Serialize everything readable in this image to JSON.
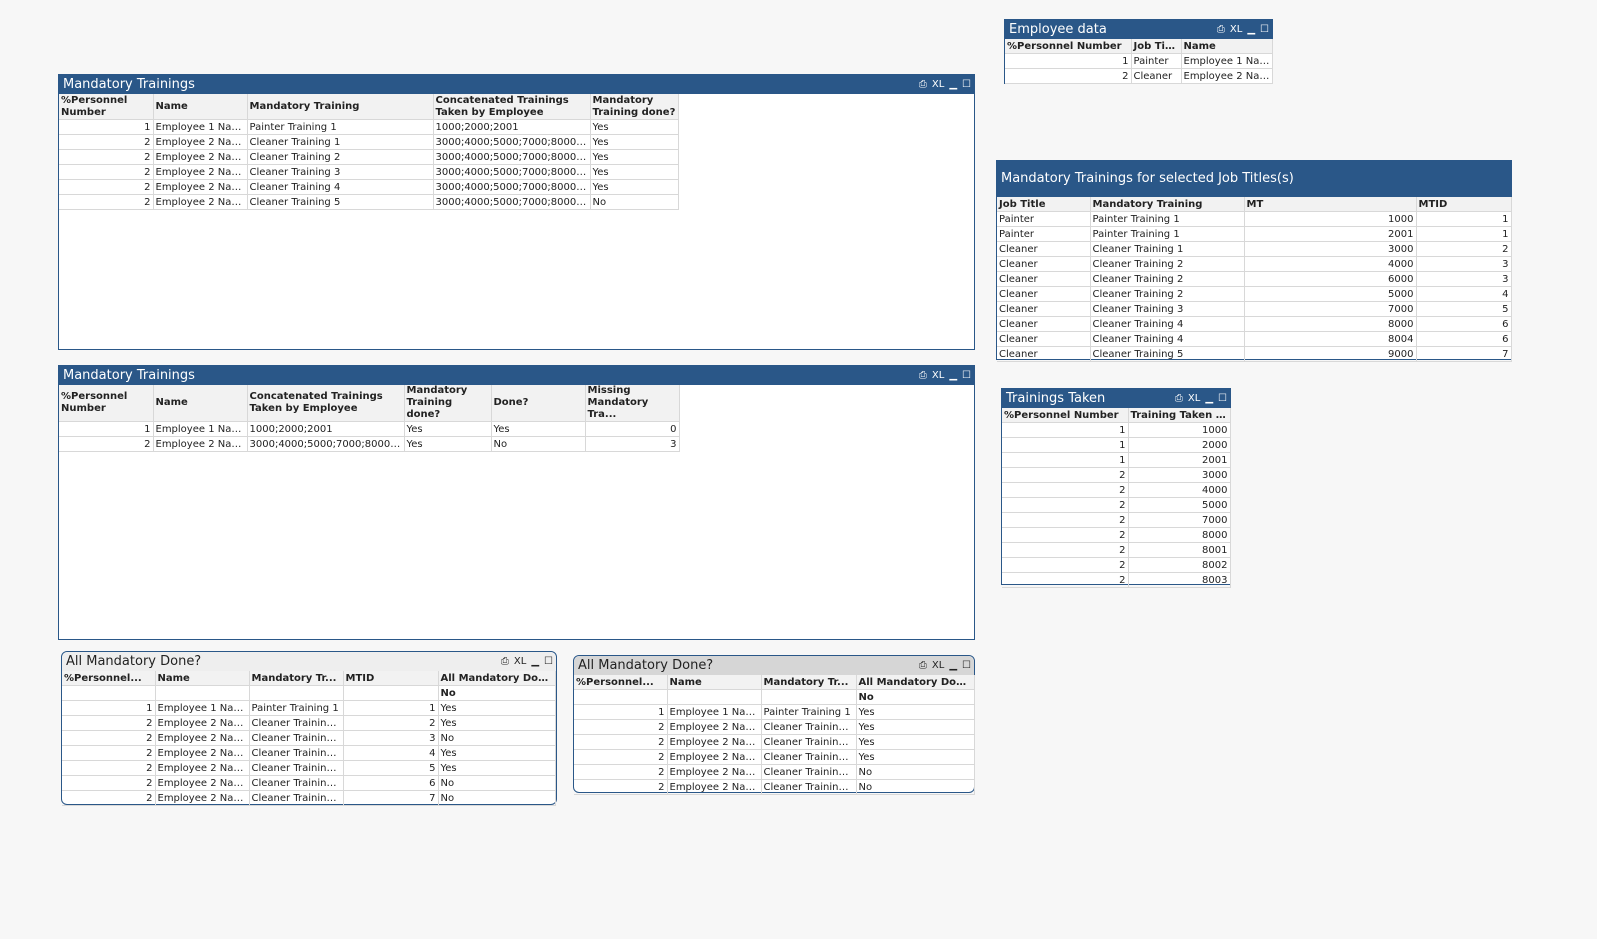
{
  "controls": {
    "print": "⎙",
    "xl": "XL",
    "min": "▁",
    "max": "☐"
  },
  "colors": {
    "title_bar": "#2a5788",
    "background": "#f7f7f7"
  },
  "panels": [
    {
      "id": "mt1",
      "title": "Mandatory Trainings",
      "headers": [
        "%Personnel Number",
        "Name",
        "Mandatory Training",
        "Concatenated Trainings Taken by Employee",
        "Mandatory Training done?"
      ],
      "rows": [
        [
          "1",
          "Employee 1 Name",
          "Painter Training 1",
          "1000;2000;2001",
          "Yes"
        ],
        [
          "2",
          "Employee 2 Name",
          "Cleaner Training 1",
          "3000;4000;5000;7000;8000;...",
          "Yes"
        ],
        [
          "2",
          "Employee 2 Name",
          "Cleaner Training 2",
          "3000;4000;5000;7000;8000;...",
          "Yes"
        ],
        [
          "2",
          "Employee 2 Name",
          "Cleaner Training 3",
          "3000;4000;5000;7000;8000;...",
          "Yes"
        ],
        [
          "2",
          "Employee 2 Name",
          "Cleaner Training 4",
          "3000;4000;5000;7000;8000;...",
          "Yes"
        ],
        [
          "2",
          "Employee 2 Name",
          "Cleaner Training 5",
          "3000;4000;5000;7000;8000;...",
          "No"
        ]
      ]
    },
    {
      "id": "mt2",
      "title": "Mandatory Trainings",
      "headers": [
        "%Personnel Number",
        "Name",
        "Concatenated Trainings Taken by Employee",
        "Mandatory Training done?",
        "Done?",
        "Missing Mandatory Tra..."
      ],
      "rows": [
        [
          "1",
          "Employee 1 Name",
          "1000;2000;2001",
          "Yes",
          "Yes",
          "0"
        ],
        [
          "2",
          "Employee 2 Name",
          "3000;4000;5000;7000;8000;...",
          "Yes",
          "No",
          "3"
        ]
      ]
    },
    {
      "id": "amd1",
      "title": "All Mandatory Done?",
      "headers": [
        "%Personnel...",
        "Name",
        "Mandatory Tr...",
        "MTID",
        "All Mandatory Done?"
      ],
      "total": [
        "",
        "",
        "",
        "",
        "No"
      ],
      "rows": [
        [
          "1",
          "Employee 1 Name",
          "Painter Training 1",
          "1",
          "Yes"
        ],
        [
          "2",
          "Employee 2 Name",
          "Cleaner Training 1",
          "2",
          "Yes"
        ],
        [
          "2",
          "Employee 2 Name",
          "Cleaner Training 2",
          "3",
          "No"
        ],
        [
          "2",
          "Employee 2 Name",
          "Cleaner Training 2",
          "4",
          "Yes"
        ],
        [
          "2",
          "Employee 2 Name",
          "Cleaner Training 3",
          "5",
          "Yes"
        ],
        [
          "2",
          "Employee 2 Name",
          "Cleaner Training 4",
          "6",
          "No"
        ],
        [
          "2",
          "Employee 2 Name",
          "Cleaner Training 5",
          "7",
          "No"
        ]
      ]
    },
    {
      "id": "amd2",
      "title": "All Mandatory Done?",
      "headers": [
        "%Personnel...",
        "Name",
        "Mandatory Tr...",
        "All Mandatory Done?"
      ],
      "total": [
        "",
        "",
        "",
        "No"
      ],
      "rows": [
        [
          "1",
          "Employee 1 Name",
          "Painter Training 1",
          "Yes"
        ],
        [
          "2",
          "Employee 2 Name",
          "Cleaner Training 1",
          "Yes"
        ],
        [
          "2",
          "Employee 2 Name",
          "Cleaner Training 2",
          "Yes"
        ],
        [
          "2",
          "Employee 2 Name",
          "Cleaner Training 3",
          "Yes"
        ],
        [
          "2",
          "Employee 2 Name",
          "Cleaner Training 4",
          "No"
        ],
        [
          "2",
          "Employee 2 Name",
          "Cleaner Training 5",
          "No"
        ]
      ]
    },
    {
      "id": "emp",
      "title": "Employee data",
      "headers": [
        "%Personnel Number",
        "Job Title",
        "Name"
      ],
      "rows": [
        [
          "1",
          "Painter",
          "Employee 1 Name"
        ],
        [
          "2",
          "Cleaner",
          "Employee 2 Name"
        ]
      ]
    },
    {
      "id": "mtsel",
      "title": "Mandatory Trainings for selected Job Titles(s)",
      "headers": [
        "Job Title",
        "Mandatory Training",
        "MT",
        "MTID"
      ],
      "rows": [
        [
          "Painter",
          "Painter Training 1",
          "1000",
          "1"
        ],
        [
          "Painter",
          "Painter Training 1",
          "2001",
          "1"
        ],
        [
          "Cleaner",
          "Cleaner Training 1",
          "3000",
          "2"
        ],
        [
          "Cleaner",
          "Cleaner Training 2",
          "4000",
          "3"
        ],
        [
          "Cleaner",
          "Cleaner Training 2",
          "6000",
          "3"
        ],
        [
          "Cleaner",
          "Cleaner Training 2",
          "5000",
          "4"
        ],
        [
          "Cleaner",
          "Cleaner Training 3",
          "7000",
          "5"
        ],
        [
          "Cleaner",
          "Cleaner Training 4",
          "8000",
          "6"
        ],
        [
          "Cleaner",
          "Cleaner Training 4",
          "8004",
          "6"
        ],
        [
          "Cleaner",
          "Cleaner Training 5",
          "9000",
          "7"
        ]
      ]
    },
    {
      "id": "tt",
      "title": "Trainings Taken",
      "headers": [
        "%Personnel Number",
        "Training Taken ID"
      ],
      "rows": [
        [
          "1",
          "1000"
        ],
        [
          "1",
          "2000"
        ],
        [
          "1",
          "2001"
        ],
        [
          "2",
          "3000"
        ],
        [
          "2",
          "4000"
        ],
        [
          "2",
          "5000"
        ],
        [
          "2",
          "7000"
        ],
        [
          "2",
          "8000"
        ],
        [
          "2",
          "8001"
        ],
        [
          "2",
          "8002"
        ],
        [
          "2",
          "8003"
        ]
      ]
    }
  ]
}
